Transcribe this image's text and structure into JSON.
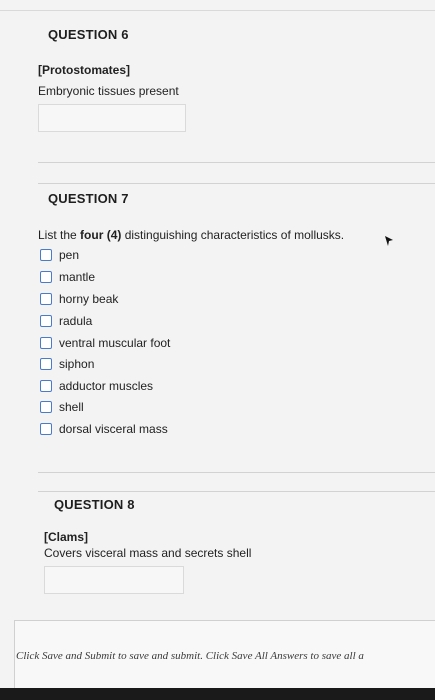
{
  "questions": [
    {
      "title": "QUESTION 6",
      "tag": "[Protostomates]",
      "prompt": "Embryonic tissues present"
    },
    {
      "title": "QUESTION 7",
      "prompt_before": "List the ",
      "prompt_bold": "four (4)",
      "prompt_after": " distinguishing characteristics of mollusks.",
      "options": [
        "pen",
        "mantle",
        "horny beak",
        "radula",
        "ventral muscular foot",
        "siphon",
        "adductor muscles",
        "shell",
        "dorsal visceral mass"
      ]
    },
    {
      "title": "QUESTION 8",
      "tag": "[Clams]",
      "prompt": "Covers visceral mass and secrets shell"
    }
  ],
  "footer": {
    "instructions": "Click Save and Submit to save and submit. Click Save All Answers to save all a"
  },
  "colors": {
    "background": "#f3f3f3",
    "checkbox_border": "#4a7bc8",
    "bottom_bar": "#1a1a1a"
  },
  "icons": {
    "cursor": "mouse-pointer-icon"
  }
}
